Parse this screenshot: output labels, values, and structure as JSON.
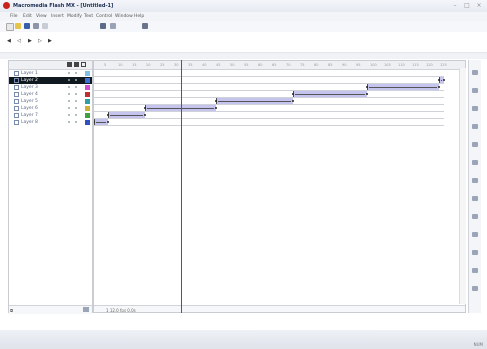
{
  "window": {
    "title": "Macromedia Flash MX - [Untitled-1]",
    "minimize_glyph": "–",
    "maximize_glyph": "□",
    "close_glyph": "×"
  },
  "menu": [
    "File",
    "Edit",
    "View",
    "Insert",
    "Modify",
    "Text",
    "Control",
    "Window",
    "Help"
  ],
  "toolbar_icons": [
    "new-document-icon",
    "open-icon",
    "save-icon",
    "print-icon",
    "cut-icon",
    "undo-icon",
    "redo-icon",
    "snap-icon"
  ],
  "playback_icons": [
    {
      "name": "rewind-icon",
      "glyph": "◀"
    },
    {
      "name": "step-back-icon",
      "glyph": "◁"
    },
    {
      "name": "play-icon",
      "glyph": "▶"
    },
    {
      "name": "step-forward-icon",
      "glyph": "▷"
    },
    {
      "name": "end-icon",
      "glyph": "▶"
    }
  ],
  "layers": [
    {
      "name": "Layer 1",
      "selected": false,
      "color": "#7fc0e8"
    },
    {
      "name": "Layer 2",
      "selected": true,
      "color": "#3a6fd8"
    },
    {
      "name": "Layer 3",
      "selected": false,
      "color": "#d050d0"
    },
    {
      "name": "Layer 4",
      "selected": false,
      "color": "#c03030"
    },
    {
      "name": "Layer 5",
      "selected": false,
      "color": "#30a0a0"
    },
    {
      "name": "Layer 6",
      "selected": false,
      "color": "#d0b030"
    },
    {
      "name": "Layer 7",
      "selected": false,
      "color": "#40a040"
    },
    {
      "name": "Layer 8",
      "selected": false,
      "color": "#3050c0"
    }
  ],
  "layers_footer": "add-layer",
  "timeline": {
    "frame_labels": [
      "5",
      "10",
      "15",
      "20",
      "25",
      "30",
      "35",
      "40",
      "45",
      "50",
      "55",
      "60",
      "65",
      "70",
      "75",
      "80",
      "85",
      "90",
      "95",
      "100",
      "105",
      "110",
      "115",
      "120",
      "125"
    ],
    "playhead_frame": 1,
    "status": "1  12.0 fps  0.0s",
    "tweens": [
      {
        "row": 2,
        "start": 0.985,
        "end": 1.0
      },
      {
        "row": 3,
        "start": 0.78,
        "end": 0.985
      },
      {
        "row": 4,
        "start": 0.57,
        "end": 0.78
      },
      {
        "row": 5,
        "start": 0.35,
        "end": 0.57
      },
      {
        "row": 6,
        "start": 0.145,
        "end": 0.35
      },
      {
        "row": 7,
        "start": 0.04,
        "end": 0.145
      },
      {
        "row": 8,
        "start": 0.0,
        "end": 0.04
      }
    ]
  },
  "status_bar_text": "NUM"
}
